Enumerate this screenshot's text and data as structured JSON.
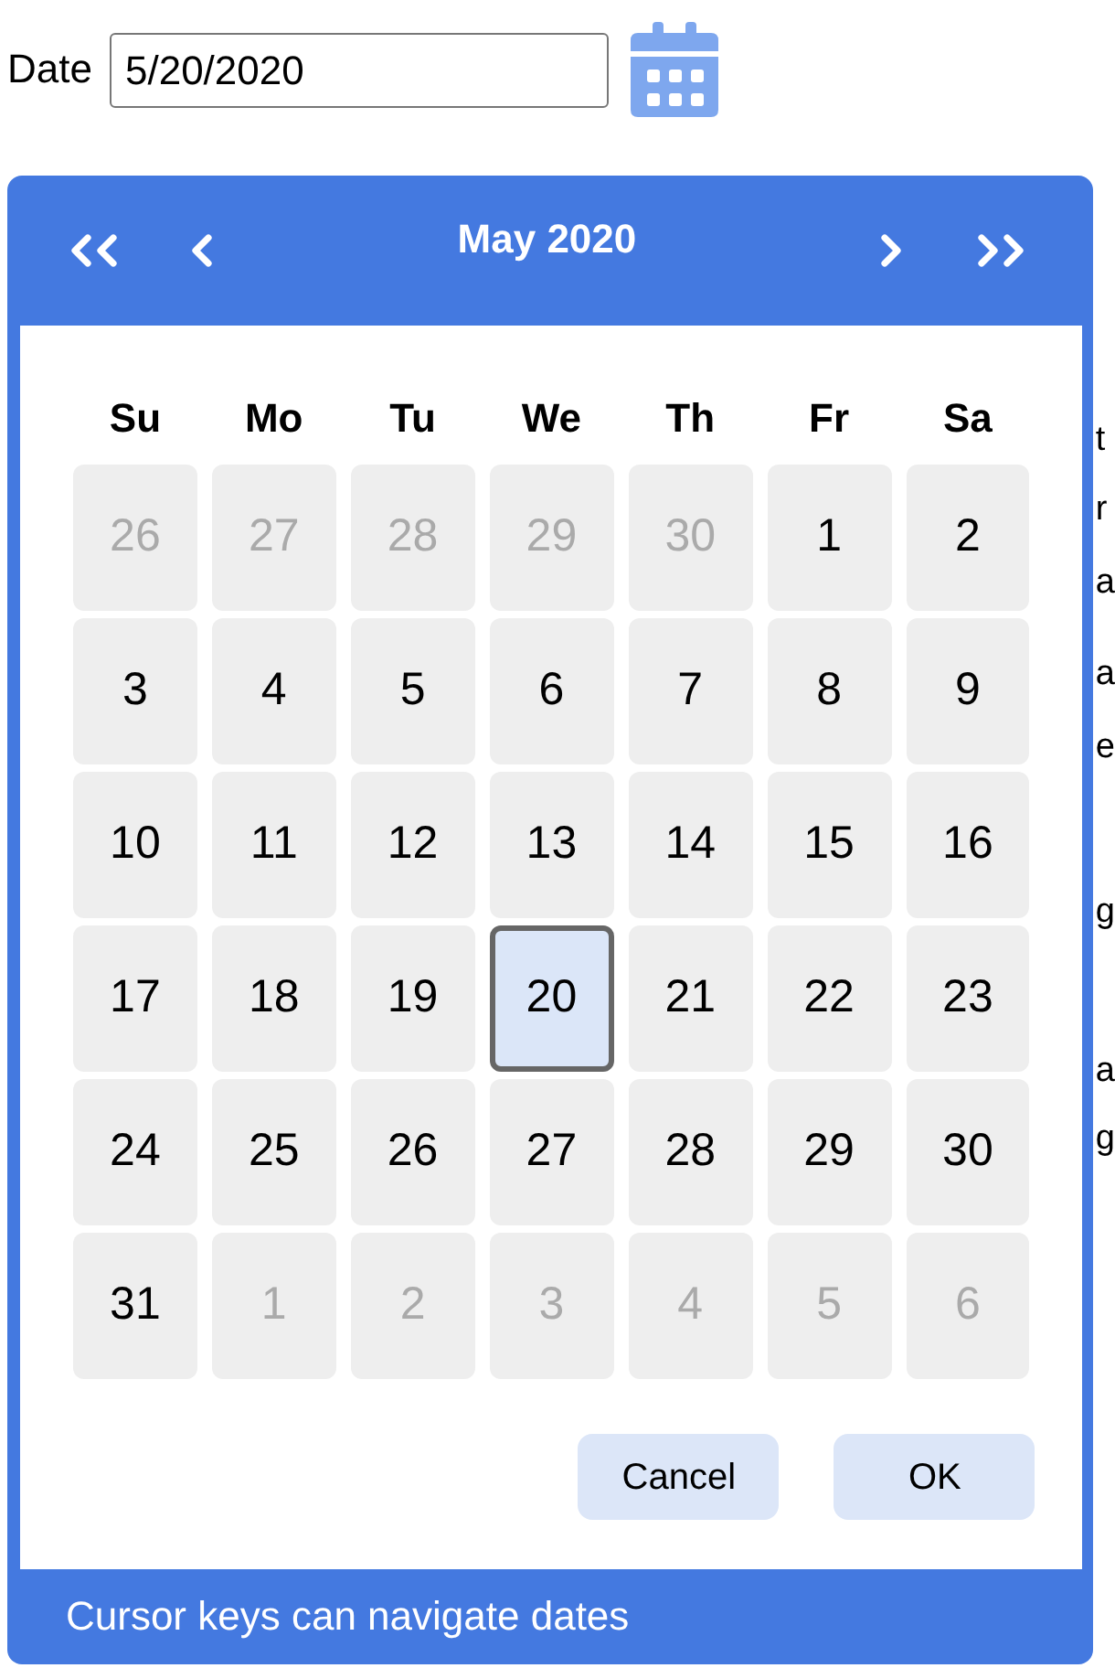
{
  "date_field": {
    "label": "Date",
    "value": "5/20/2020"
  },
  "calendar": {
    "title": "May 2020",
    "weekdays": [
      "Su",
      "Mo",
      "Tu",
      "We",
      "Th",
      "Fr",
      "Sa"
    ],
    "weeks": [
      [
        {
          "day": "26",
          "other_month": true,
          "selected": false
        },
        {
          "day": "27",
          "other_month": true,
          "selected": false
        },
        {
          "day": "28",
          "other_month": true,
          "selected": false
        },
        {
          "day": "29",
          "other_month": true,
          "selected": false
        },
        {
          "day": "30",
          "other_month": true,
          "selected": false
        },
        {
          "day": "1",
          "other_month": false,
          "selected": false
        },
        {
          "day": "2",
          "other_month": false,
          "selected": false
        }
      ],
      [
        {
          "day": "3",
          "other_month": false,
          "selected": false
        },
        {
          "day": "4",
          "other_month": false,
          "selected": false
        },
        {
          "day": "5",
          "other_month": false,
          "selected": false
        },
        {
          "day": "6",
          "other_month": false,
          "selected": false
        },
        {
          "day": "7",
          "other_month": false,
          "selected": false
        },
        {
          "day": "8",
          "other_month": false,
          "selected": false
        },
        {
          "day": "9",
          "other_month": false,
          "selected": false
        }
      ],
      [
        {
          "day": "10",
          "other_month": false,
          "selected": false
        },
        {
          "day": "11",
          "other_month": false,
          "selected": false
        },
        {
          "day": "12",
          "other_month": false,
          "selected": false
        },
        {
          "day": "13",
          "other_month": false,
          "selected": false
        },
        {
          "day": "14",
          "other_month": false,
          "selected": false
        },
        {
          "day": "15",
          "other_month": false,
          "selected": false
        },
        {
          "day": "16",
          "other_month": false,
          "selected": false
        }
      ],
      [
        {
          "day": "17",
          "other_month": false,
          "selected": false
        },
        {
          "day": "18",
          "other_month": false,
          "selected": false
        },
        {
          "day": "19",
          "other_month": false,
          "selected": false
        },
        {
          "day": "20",
          "other_month": false,
          "selected": true
        },
        {
          "day": "21",
          "other_month": false,
          "selected": false
        },
        {
          "day": "22",
          "other_month": false,
          "selected": false
        },
        {
          "day": "23",
          "other_month": false,
          "selected": false
        }
      ],
      [
        {
          "day": "24",
          "other_month": false,
          "selected": false
        },
        {
          "day": "25",
          "other_month": false,
          "selected": false
        },
        {
          "day": "26",
          "other_month": false,
          "selected": false
        },
        {
          "day": "27",
          "other_month": false,
          "selected": false
        },
        {
          "day": "28",
          "other_month": false,
          "selected": false
        },
        {
          "day": "29",
          "other_month": false,
          "selected": false
        },
        {
          "day": "30",
          "other_month": false,
          "selected": false
        }
      ],
      [
        {
          "day": "31",
          "other_month": false,
          "selected": false
        },
        {
          "day": "1",
          "other_month": true,
          "selected": false
        },
        {
          "day": "2",
          "other_month": true,
          "selected": false
        },
        {
          "day": "3",
          "other_month": true,
          "selected": false
        },
        {
          "day": "4",
          "other_month": true,
          "selected": false
        },
        {
          "day": "5",
          "other_month": true,
          "selected": false
        },
        {
          "day": "6",
          "other_month": true,
          "selected": false
        }
      ]
    ],
    "buttons": [
      "Cancel",
      "OK"
    ],
    "hint": "Cursor keys can navigate dates"
  },
  "background_text": [
    "t",
    "r",
    "a",
    "a",
    "e",
    "g",
    "a",
    "g"
  ]
}
